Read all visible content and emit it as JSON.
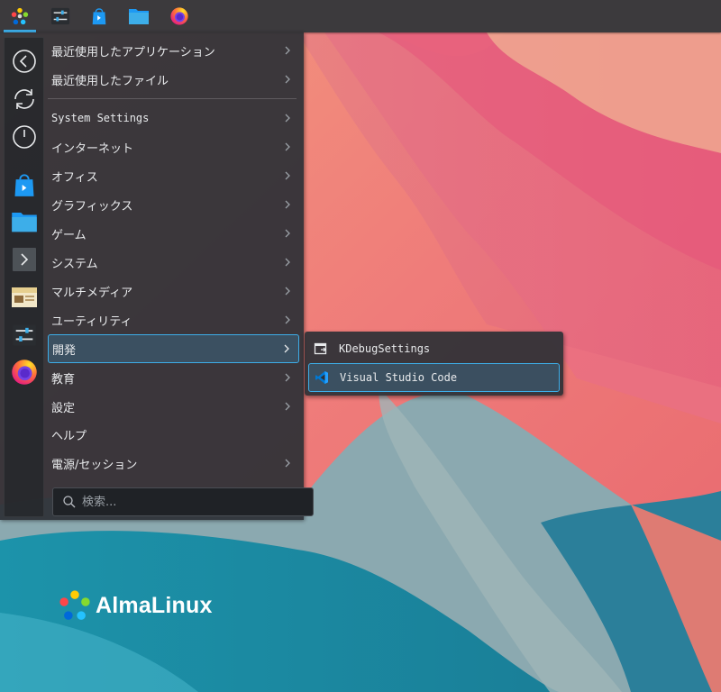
{
  "panel": {
    "buttons": [
      {
        "name": "application-launcher",
        "icon": "almalinux-logo-icon"
      },
      {
        "name": "system-settings",
        "icon": "settings-sliders-icon"
      },
      {
        "name": "discover-store",
        "icon": "store-bag-icon"
      },
      {
        "name": "file-manager",
        "icon": "folder-icon"
      },
      {
        "name": "firefox",
        "icon": "firefox-icon"
      }
    ]
  },
  "sidebar": {
    "items": [
      {
        "name": "back",
        "icon": "back-circle-icon"
      },
      {
        "name": "session-switch",
        "icon": "refresh-circle-icon"
      },
      {
        "name": "power",
        "icon": "power-icon"
      },
      {
        "name": "discover",
        "icon": "store-bag-icon"
      },
      {
        "name": "files",
        "icon": "folder-icon"
      },
      {
        "name": "terminal",
        "icon": "terminal-icon"
      },
      {
        "name": "archive",
        "icon": "archive-box-icon"
      },
      {
        "name": "settings",
        "icon": "settings-sliders-icon"
      },
      {
        "name": "firefox",
        "icon": "firefox-icon"
      }
    ]
  },
  "menu": {
    "recent_apps": "最近使用したアプリケーション",
    "recent_files": "最近使用したファイル",
    "items": [
      {
        "label": "System Settings",
        "mono": true
      },
      {
        "label": "インターネット"
      },
      {
        "label": "オフィス"
      },
      {
        "label": "グラフィックス"
      },
      {
        "label": "ゲーム"
      },
      {
        "label": "システム"
      },
      {
        "label": "マルチメディア"
      },
      {
        "label": "ユーティリティ"
      },
      {
        "label": "開発",
        "highlighted": true
      },
      {
        "label": "教育"
      },
      {
        "label": "設定"
      },
      {
        "label": "ヘルプ"
      },
      {
        "label": "電源/セッション"
      }
    ],
    "search_placeholder": "検索..."
  },
  "submenu": {
    "items": [
      {
        "label": "KDebugSettings",
        "icon": "kdebug-icon"
      },
      {
        "label": "Visual Studio Code",
        "icon": "vscode-icon",
        "highlighted": true
      }
    ]
  },
  "desktop": {
    "logo_text": "AlmaLinux"
  },
  "colors": {
    "accent": "#3daee9",
    "panel": "#3c3a3d",
    "menu_bg": "#2d3036"
  }
}
